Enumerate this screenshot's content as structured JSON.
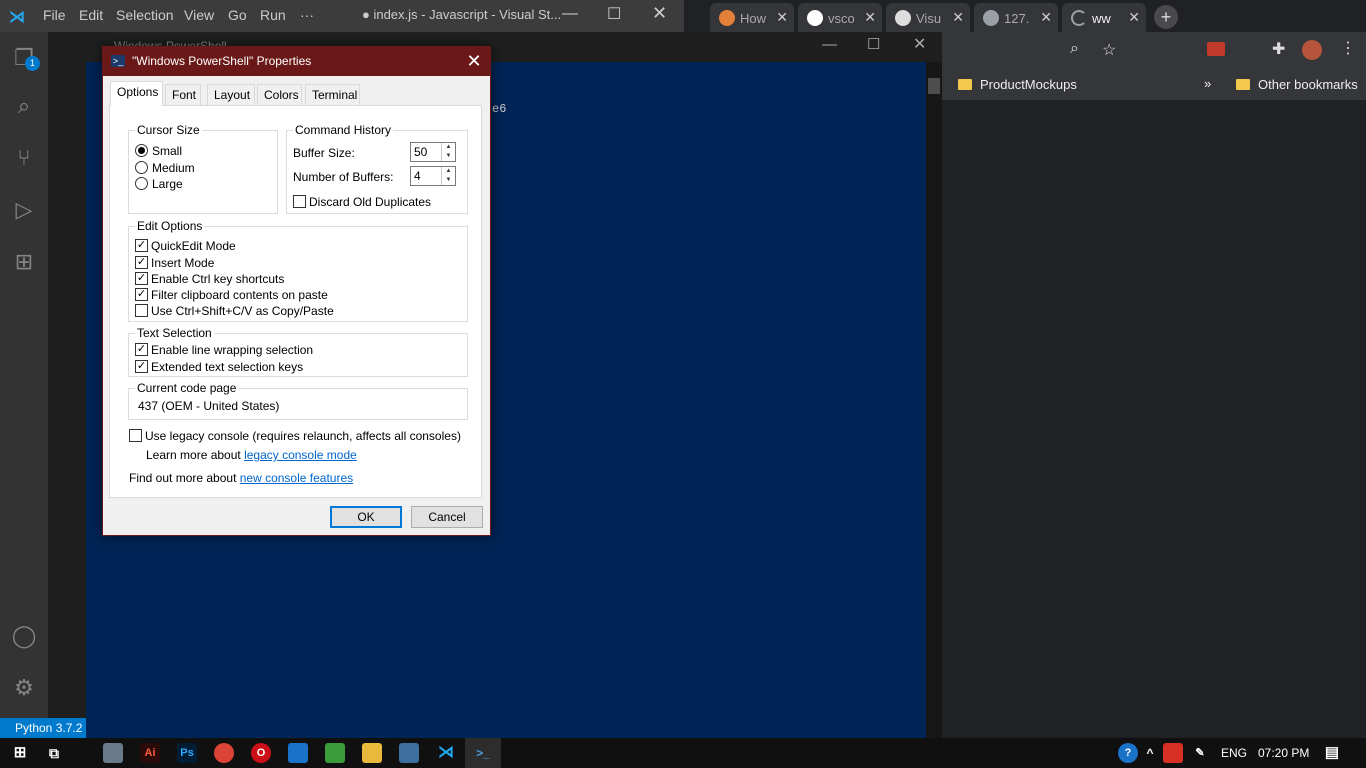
{
  "vscode": {
    "menu": [
      "File",
      "Edit",
      "Selection",
      "View",
      "Go",
      "Run",
      "···"
    ],
    "window_title": "● index.js - Javascript - Visual St...",
    "status_python": "Python 3.7.2",
    "notification_count": "1"
  },
  "powershell_window": {
    "title": "Windows PowerShell",
    "visible_text_fragment": "e6"
  },
  "chrome": {
    "tabs": [
      {
        "label": "How",
        "icon_color": "#e3803a"
      },
      {
        "label": "vsco",
        "icon_color": "#ffffff"
      },
      {
        "label": "Visu",
        "icon_color": "#dddddd"
      },
      {
        "label": "127.",
        "icon_color": "#9aa0a6"
      },
      {
        "label": "ww",
        "icon_color": "#9aa0a6"
      }
    ],
    "bookmarks": {
      "folder": "ProductMockups",
      "overflow": "»",
      "other": "Other bookmarks"
    }
  },
  "dialog": {
    "title": "\"Windows PowerShell\" Properties",
    "tabs": [
      "Options",
      "Font",
      "Layout",
      "Colors",
      "Terminal"
    ],
    "cursor_size": {
      "legend": "Cursor Size",
      "options": [
        "Small",
        "Medium",
        "Large"
      ],
      "selected": "Small"
    },
    "command_history": {
      "legend": "Command History",
      "buffer_size_label": "Buffer Size:",
      "buffer_size_value": "50",
      "num_buffers_label": "Number of Buffers:",
      "num_buffers_value": "4",
      "discard_label": "Discard Old Duplicates",
      "discard_checked": false
    },
    "edit_options": {
      "legend": "Edit Options",
      "items": [
        {
          "label": "QuickEdit Mode",
          "checked": true
        },
        {
          "label": "Insert Mode",
          "checked": true
        },
        {
          "label": "Enable Ctrl key shortcuts",
          "checked": true
        },
        {
          "label": "Filter clipboard contents on paste",
          "checked": true
        },
        {
          "label": "Use Ctrl+Shift+C/V as Copy/Paste",
          "checked": false
        }
      ]
    },
    "text_selection": {
      "legend": "Text Selection",
      "items": [
        {
          "label": "Enable line wrapping selection",
          "checked": true
        },
        {
          "label": "Extended text selection keys",
          "checked": true
        }
      ]
    },
    "code_page": {
      "legend": "Current code page",
      "value": "437   (OEM - United States)"
    },
    "legacy": {
      "label": "Use legacy console (requires relaunch, affects all consoles)",
      "checked": false,
      "learn_prefix": "Learn more about ",
      "learn_link": "legacy console mode"
    },
    "find_out": {
      "prefix": "Find out more about ",
      "link": "new console features"
    },
    "ok": "OK",
    "cancel": "Cancel"
  },
  "taskbar": {
    "language": "ENG",
    "time": "07:20 PM"
  }
}
